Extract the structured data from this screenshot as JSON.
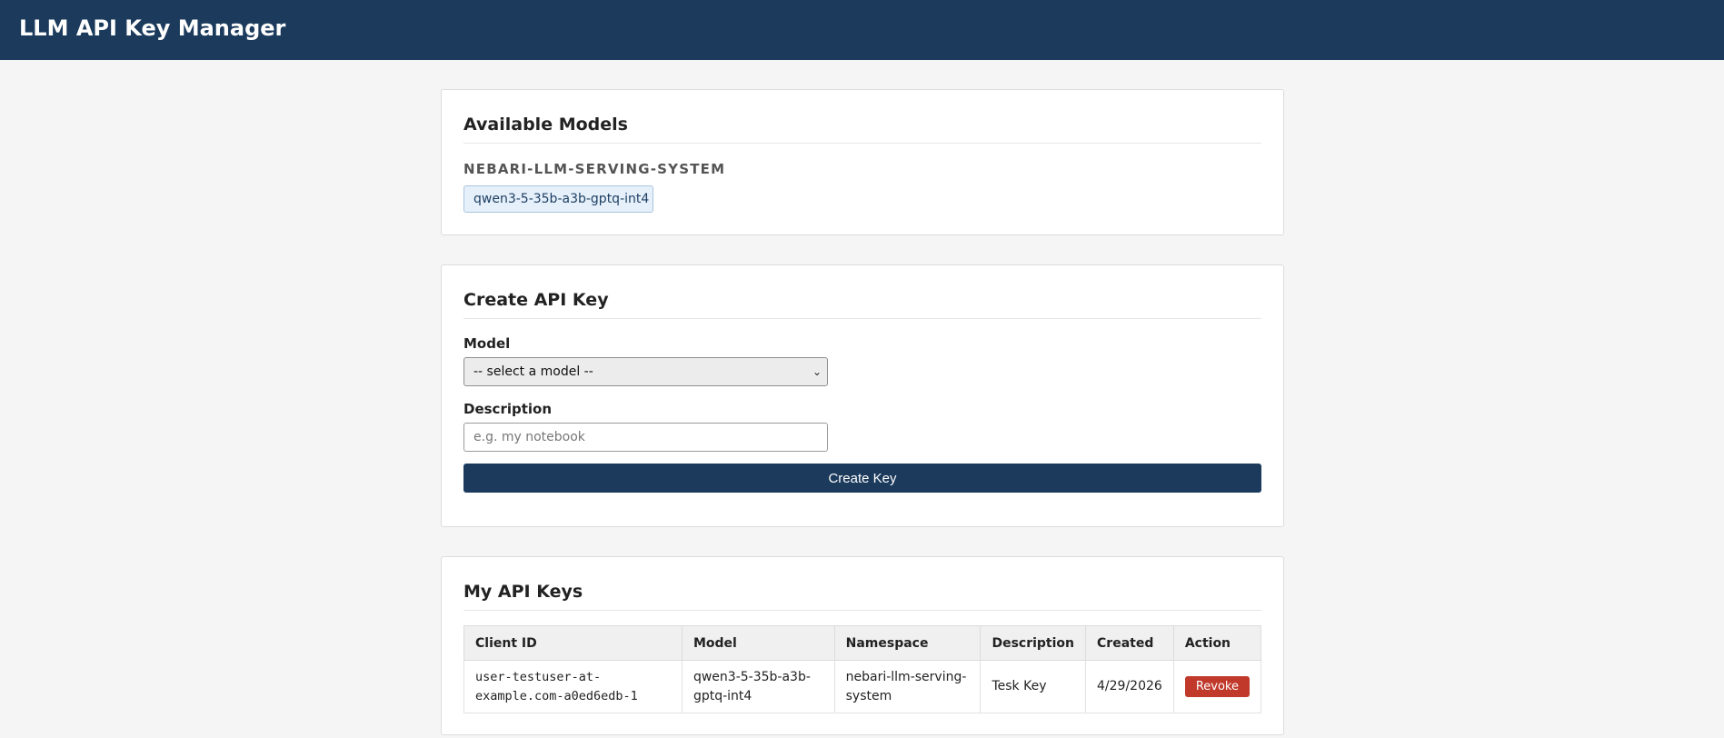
{
  "app": {
    "title": "LLM API Key Manager"
  },
  "available_models": {
    "heading": "Available Models",
    "namespace": "NEBARI-LLM-SERVING-SYSTEM",
    "models": [
      "qwen3-5-35b-a3b-gptq-int4"
    ]
  },
  "create_key": {
    "heading": "Create API Key",
    "model_label": "Model",
    "model_select_value": "-- select a model --",
    "description_label": "Description",
    "description_placeholder": "e.g. my notebook",
    "description_value": "",
    "submit_label": "Create Key"
  },
  "my_keys": {
    "heading": "My API Keys",
    "columns": [
      "Client ID",
      "Model",
      "Namespace",
      "Description",
      "Created",
      "Action"
    ],
    "rows": [
      {
        "client_id": "user-testuser-at-example.com-a0ed6edb-1",
        "model": "qwen3-5-35b-a3b-gptq-int4",
        "namespace": "nebari-llm-serving-system",
        "description": "Tesk Key",
        "created": "4/29/2026",
        "action_label": "Revoke"
      }
    ]
  },
  "colors": {
    "header_bg": "#1b3a5c",
    "primary": "#1b3a5c",
    "danger": "#c0392b",
    "chip_bg": "#e6f0fa"
  },
  "icons": {
    "select_chevron": "chevron-down-icon"
  }
}
